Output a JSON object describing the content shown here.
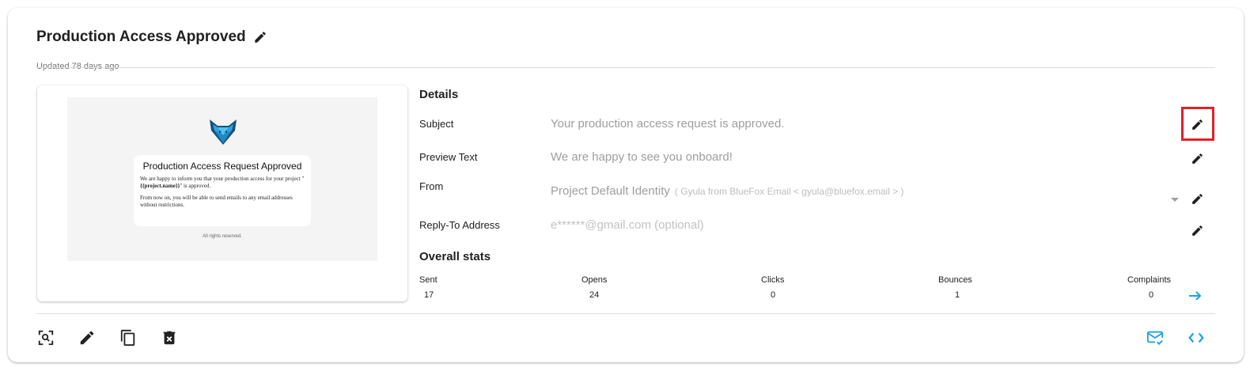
{
  "header": {
    "title": "Production Access Approved",
    "updated": "Updated 78 days ago"
  },
  "preview": {
    "mail_title": "Production Access Request Approved",
    "body_line1": "We are happy to inform you that your production access for your project \"",
    "project_var": "{{project.name}}",
    "body_line1_end": "\" is approved.",
    "body_line2": "From now on, you will be able to send emails to any email addresses without restrictions.",
    "footer": "All rights reserved."
  },
  "details": {
    "title": "Details",
    "subject_label": "Subject",
    "subject_value": "Your production access request is approved.",
    "preview_label": "Preview Text",
    "preview_value": "We are happy to see you onboard!",
    "from_label": "From",
    "from_value": "Project Default Identity",
    "from_sub": "( Gyula from BlueFox Email < gyula@bluefox.email > )",
    "reply_label": "Reply-To Address",
    "reply_placeholder": "e******@gmail.com (optional)"
  },
  "stats": {
    "title": "Overall stats",
    "sent_label": "Sent",
    "sent_value": "17",
    "opens_label": "Opens",
    "opens_value": "24",
    "clicks_label": "Clicks",
    "clicks_value": "0",
    "bounces_label": "Bounces",
    "bounces_value": "1",
    "complaints_label": "Complaints",
    "complaints_value": "0"
  },
  "colors": {
    "accent": "#1ba1e2",
    "highlight": "#e0202a",
    "icon": "#212121"
  }
}
